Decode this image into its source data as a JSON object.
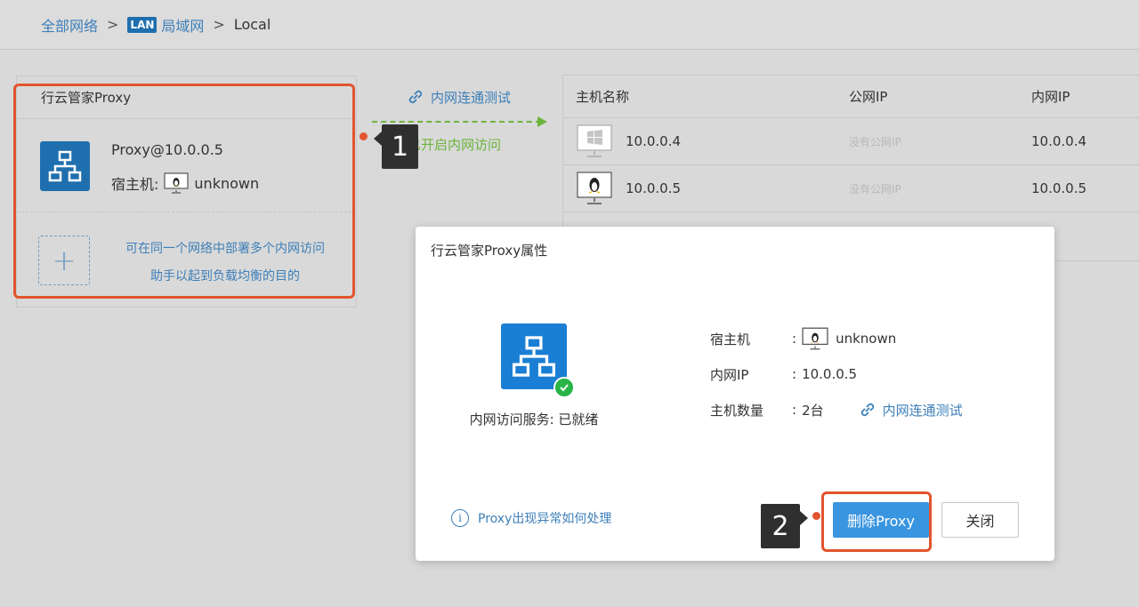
{
  "breadcrumb": {
    "root": "全部网络",
    "sep1": ">",
    "lan_badge": "LAN",
    "lan_label": "局域网",
    "sep2": ">",
    "current": "Local"
  },
  "proxy_card": {
    "title": "行云管家Proxy",
    "proxy_name": "Proxy@10.0.0.5",
    "host_label": "宿主机:",
    "host_value": "unknown",
    "add_hint_line1": "可在同一个网络中部署多个内网访问",
    "add_hint_line2": "助手以起到负载均衡的目的",
    "add_symbol": "+"
  },
  "middle": {
    "test_link": "内网连通测试",
    "status": "已开启内网访问"
  },
  "host_table": {
    "headers": [
      "主机名称",
      "公网IP",
      "内网IP"
    ],
    "rows": [
      {
        "name": "10.0.0.4",
        "public_ip": "没有公网IP",
        "private_ip": "10.0.0.4",
        "os": "windows-icon"
      },
      {
        "name": "10.0.0.5",
        "public_ip": "没有公网IP",
        "private_ip": "10.0.0.5",
        "os": "linux-icon"
      }
    ]
  },
  "modal": {
    "title": "行云管家Proxy属性",
    "service_status": "内网访问服务: 已就绪",
    "props": {
      "host_label": "宿主机",
      "host_value": "unknown",
      "ip_label": "内网IP",
      "ip_value": "10.0.0.5",
      "count_label": "主机数量",
      "count_value": "2台",
      "test_link": "内网连通测试"
    },
    "help_link": "Proxy出现异常如何处理",
    "delete_button": "删除Proxy",
    "close_button": "关闭"
  },
  "annotations": {
    "badge1": "1",
    "badge2": "2",
    "highlight_color": "#e2542d"
  },
  "colors": {
    "accent": "#3d7fb8",
    "primary_button": "#3a95e0",
    "success": "#6bb43c",
    "proxy_icon": "#1f6fae"
  }
}
